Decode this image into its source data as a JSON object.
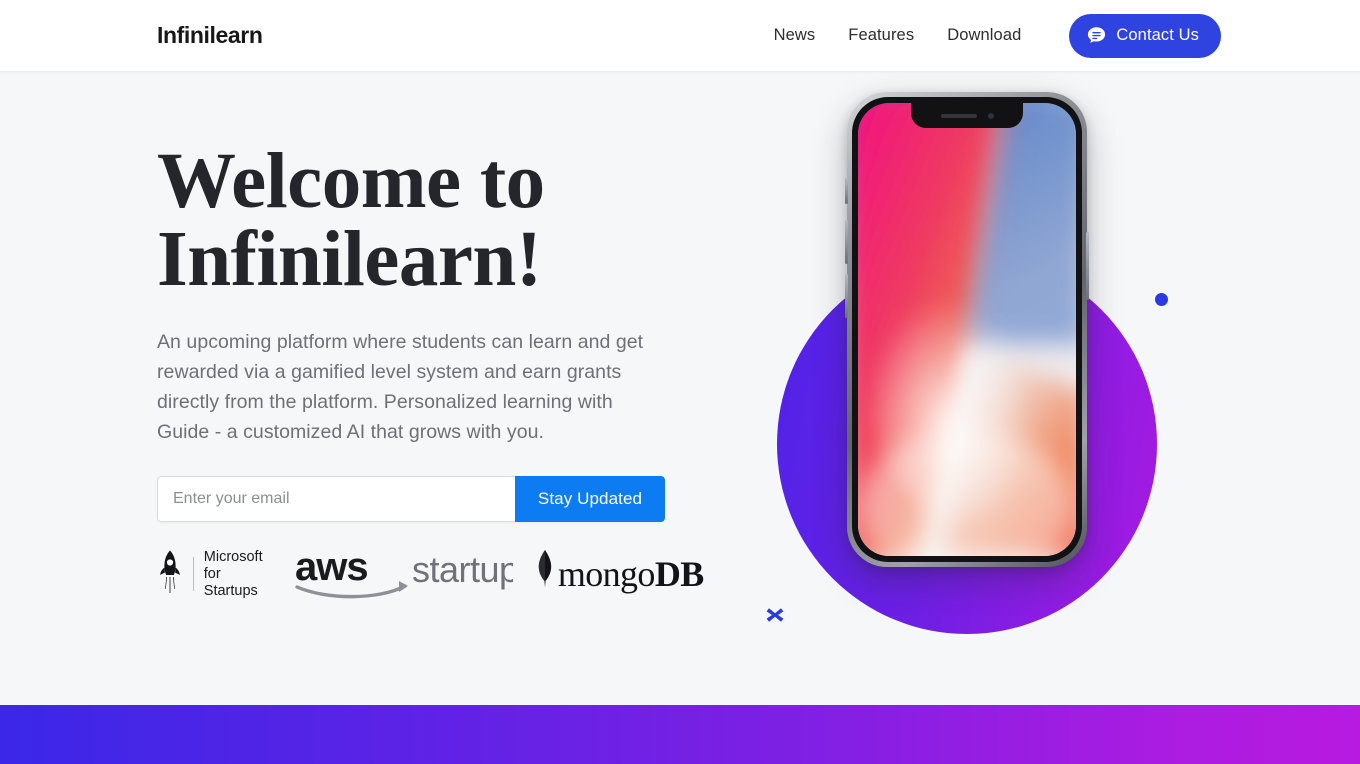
{
  "header": {
    "brand": "Infinilearn",
    "nav": [
      {
        "label": "News"
      },
      {
        "label": "Features"
      },
      {
        "label": "Download"
      }
    ],
    "contact": {
      "label": "Contact Us",
      "icon": "chat-bubble-icon",
      "color": "#2f43e0"
    }
  },
  "hero": {
    "headline": "Welcome to Infinilearn!",
    "subcopy": "An upcoming platform where students can learn and get rewarded via a gamified level system and earn grants directly from the platform. Personalized learning with Guide - a customized AI that grows with you.",
    "signup": {
      "placeholder": "Enter your email",
      "value": "",
      "button_label": "Stay Updated",
      "button_color": "#0d7bf2"
    },
    "partners": [
      {
        "name": "Microsoft for Startups",
        "line1": "Microsoft",
        "line2": "for Startups",
        "icon": "rocket-icon"
      },
      {
        "name": "AWS Startups",
        "aws": "aws",
        "word": "startups"
      },
      {
        "name": "mongoDB",
        "mongo": "mongo",
        "db": "DB",
        "icon": "mongodb-leaf-icon"
      }
    ],
    "art": {
      "device": "iphone-x-mockup",
      "blob_gradient_from": "#4f23e8",
      "blob_gradient_to": "#a81ae2",
      "decor_dot_color": "#2a3ae0",
      "decor_cross_color": "#2a3ae0"
    }
  },
  "footer_band": {
    "gradient_from": "#3b27e8",
    "gradient_to": "#b81ae0"
  }
}
